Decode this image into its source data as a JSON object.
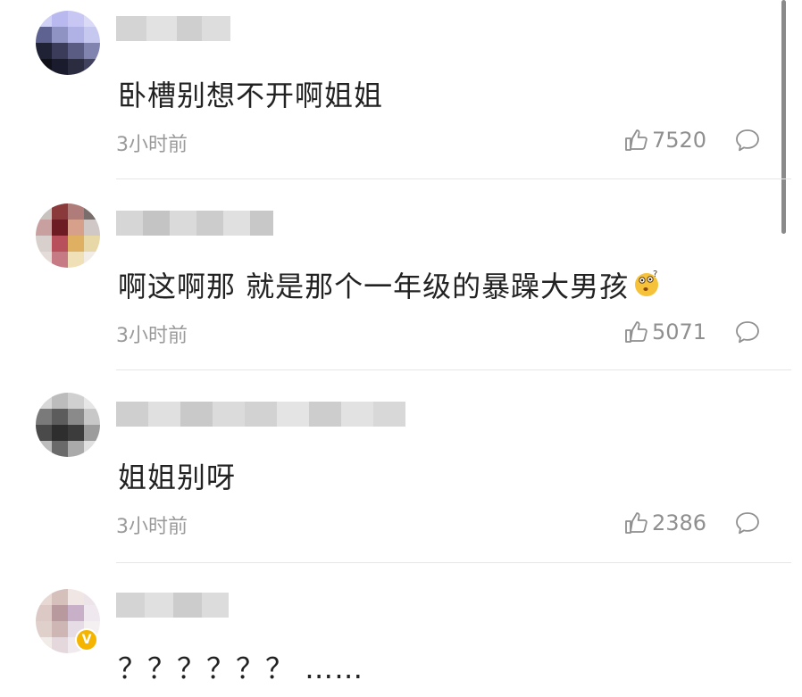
{
  "comments": [
    {
      "text": "卧槽别想不开啊姐姐",
      "time": "3小时前",
      "likes": "7520",
      "avatar_colors": [
        "#cfd0f4",
        "#b9b8ef",
        "#c8c6f2",
        "#dad9f6",
        "#5e6290",
        "#8f93c4",
        "#b0b2e6",
        "#c6c8f0",
        "#1f2135",
        "#3a3c5a",
        "#5a5c84",
        "#8284b0",
        "#0f1018",
        "#1a1b2c",
        "#2b2c40",
        "#40425e"
      ]
    },
    {
      "text": "啊这啊那 就是那个一年级的暴躁大男孩",
      "time": "3小时前",
      "likes": "5071",
      "avatar_colors": [
        "#c9c3c0",
        "#8a3a3a",
        "#b07c7a",
        "#7a6e6c",
        "#c8a0a0",
        "#6e1c24",
        "#d6a08a",
        "#d0c8c6",
        "#d8d0cc",
        "#b8505c",
        "#e0b062",
        "#e8d8a8",
        "#e4dcd8",
        "#c67a84",
        "#f0e0b8",
        "#f2ece6"
      ]
    },
    {
      "text": "姐姐别呀",
      "time": "3小时前",
      "likes": "2386",
      "avatar_colors": [
        "#d8d8d8",
        "#bcbcbc",
        "#d0d0d0",
        "#e6e6e6",
        "#7a7a7a",
        "#5c5c5c",
        "#8a8a8a",
        "#c8c8c8",
        "#4a4a4a",
        "#2e2e2e",
        "#3c3c3c",
        "#9c9c9c",
        "#bdbdbd",
        "#6a6a6a",
        "#aaaaaa",
        "#e0e0e0"
      ]
    },
    {
      "text": "？？？？？？ ……",
      "avatar_colors": [
        "#e8d8d4",
        "#d6c0bc",
        "#f0e6e4",
        "#ece4e8",
        "#dcc8c4",
        "#b89a9e",
        "#c8b0c8",
        "#efe8ee",
        "#e0d0cc",
        "#cdb6b4",
        "#e6dce6",
        "#f4f0f2",
        "#f2ece8",
        "#e4d8dc",
        "#f0eaee",
        "#f8f6f6"
      ]
    }
  ],
  "colors": {
    "text": "#222222",
    "meta": "#9a9a9a",
    "divider": "#e6e6e6",
    "verified_badge": "#f4b400"
  },
  "icons": {
    "like": "thumbs-up-outline-icon",
    "reply": "speech-bubble-icon",
    "emoji": "thinking-face-emoji",
    "verified": "verified-v-badge"
  },
  "badge_letter": "V"
}
